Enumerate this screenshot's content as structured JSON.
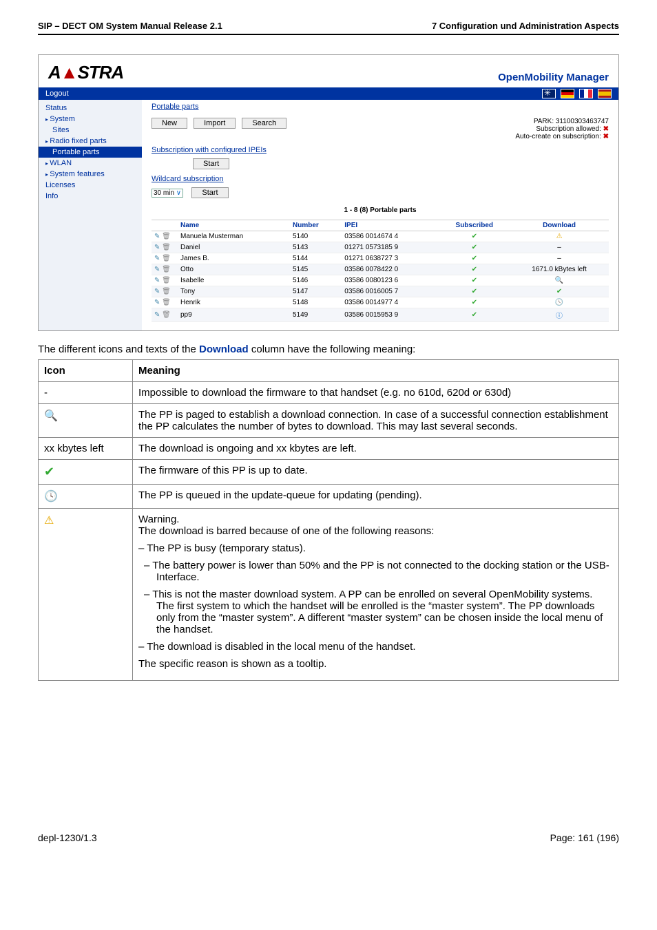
{
  "header": {
    "left": "SIP – DECT OM System Manual Release 2.1",
    "right": "7 Configuration und Administration Aspects"
  },
  "omm": {
    "logo": "AASTRA",
    "title": "OpenMobility Manager",
    "logout": "Logout",
    "side": {
      "status": "Status",
      "system": "System",
      "sites": "Sites",
      "rfp": "Radio fixed parts",
      "pp": "Portable parts",
      "wlan": "WLAN",
      "sysfeat": "System features",
      "licenses": "Licenses",
      "info": "Info"
    },
    "crumb": "Portable parts",
    "buttons": {
      "new": "New",
      "import": "Import",
      "search": "Search",
      "start": "Start"
    },
    "right_info": {
      "park": "PARK: 31100303463747",
      "suballowed": "Subscription allowed:",
      "autocreate": "Auto-create on subscription:"
    },
    "sect1": "Subscription with configured IPEIs",
    "sect2": "Wildcard subscription",
    "duration": "30 min",
    "tbl_caption": "1 - 8 (8) Portable parts",
    "tbl_headers": {
      "name": "Name",
      "number": "Number",
      "ipei": "IPEI",
      "subscribed": "Subscribed",
      "download": "Download"
    },
    "rows": [
      {
        "name": "Manuela Musterman",
        "number": "5140",
        "ipei": "03586 0014674 4",
        "dl": "warn"
      },
      {
        "name": "Daniel",
        "number": "5143",
        "ipei": "01271 0573185 9",
        "dl": "dash"
      },
      {
        "name": "James B.",
        "number": "5144",
        "ipei": "01271 0638727 3",
        "dl": "dash"
      },
      {
        "name": "Otto",
        "number": "5145",
        "ipei": "03586 0078422 0",
        "dl": "kb"
      },
      {
        "name": "Isabelle",
        "number": "5146",
        "ipei": "03586 0080123 6",
        "dl": "mag"
      },
      {
        "name": "Tony",
        "number": "5147",
        "ipei": "03586 0016005 7",
        "dl": "ok"
      },
      {
        "name": "Henrik",
        "number": "5148",
        "ipei": "03586 0014977 4",
        "dl": "clock"
      },
      {
        "name": "pp9",
        "number": "5149",
        "ipei": "03586 0015953 9",
        "dl": "info"
      }
    ],
    "kb_left": "1671.0 kBytes left"
  },
  "intro": {
    "pre": "The different icons and texts of the ",
    "dl": "Download",
    "post": " column have the following meaning:"
  },
  "tbl": {
    "h_icon": "Icon",
    "h_meaning": "Meaning",
    "r1_icon": "-",
    "r1": "Impossible to download the firmware to that handset (e.g. no 610d, 620d or 630d)",
    "r2": "The PP is paged to establish a download connection. In case of a successful connection establishment the PP calculates the number of bytes to download. This may last several seconds.",
    "r3_icon": "xx kbytes left",
    "r3": "The download is ongoing and xx kbytes are left.",
    "r4": "The firmware of this PP is up to date.",
    "r5": "The PP is queued in the update-queue for updating (pending).",
    "r6_title": "Warning.",
    "r6_sub": "The download is barred because of one of the following reasons:",
    "r6_b1": "The PP is busy (temporary status).",
    "r6_b2": "The battery power is lower than 50% and the PP is not connected to the docking station or the USB-Interface.",
    "r6_b3": "This is not the master download system. A PP can be enrolled on several OpenMobility systems. The first system to which the handset will be enrolled is the “master system”. The PP downloads only from the “master system”. A different “master system” can be chosen inside the local menu of the handset.",
    "r6_b4": "The download is disabled in the local menu of the handset.",
    "r6_end": "The specific reason is shown as a tooltip."
  },
  "footer": {
    "left": "depl-1230/1.3",
    "right": "Page: 161 (196)"
  }
}
